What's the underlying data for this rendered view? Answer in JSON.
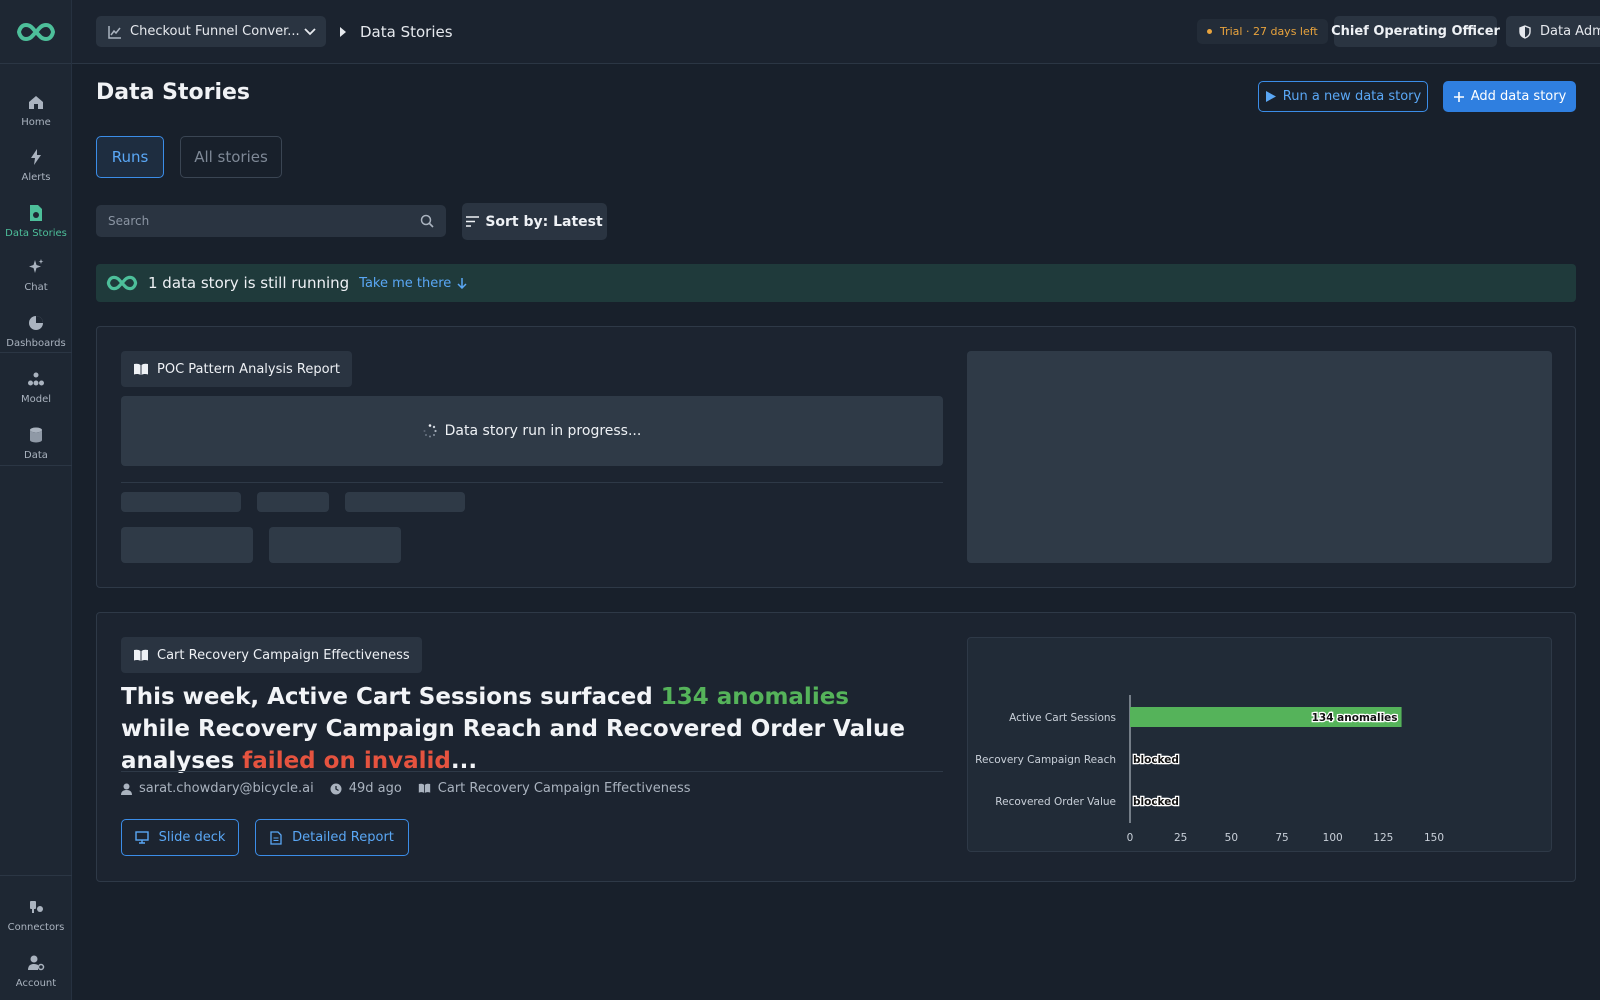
{
  "sidebar": {
    "items": [
      {
        "label": "Home"
      },
      {
        "label": "Alerts"
      },
      {
        "label": "Data Stories"
      },
      {
        "label": "Chat"
      },
      {
        "label": "Dashboards"
      },
      {
        "label": "Model"
      },
      {
        "label": "Data"
      },
      {
        "label": "Connectors"
      },
      {
        "label": "Account"
      }
    ],
    "active_item": "Data Stories"
  },
  "header": {
    "project": "Checkout Funnel Conver...",
    "breadcrumb": "Data Stories",
    "trial": "Trial · 27 days left",
    "role": "Chief Operating Officer",
    "admin": "Data Admin"
  },
  "page": {
    "title": "Data Stories",
    "run_button": "Run a new data story",
    "add_button": "Add data story",
    "tabs": [
      {
        "label": "Runs",
        "active": true
      },
      {
        "label": "All stories",
        "active": false
      }
    ],
    "search_placeholder": "Search",
    "sort_label": "Sort by: Latest"
  },
  "banner": {
    "message": "1 data story is still running",
    "link": "Take me there"
  },
  "cards": [
    {
      "title": "POC Pattern Analysis Report",
      "status": "Data story run in progress..."
    },
    {
      "title": "Cart Recovery Campaign Effectiveness",
      "headline_parts": {
        "a": "This week, Active Cart Sessions surfaced ",
        "b": "134 anomalies",
        "c": " while Recovery Campaign Reach and Recovered Order Value analyses ",
        "d": "failed on invalid",
        "e": "..."
      },
      "author": "sarat.chowdary@bicycle.ai",
      "age": "49d ago",
      "story": "Cart Recovery Campaign Effectiveness",
      "buttons": {
        "slide_deck": "Slide deck",
        "detailed_report": "Detailed Report"
      }
    }
  ],
  "colors": {
    "accent": "#2f7fe0",
    "success": "#55b35a",
    "error": "#e5533f",
    "brand": "#4dbf9a",
    "trial": "#e8a33d"
  },
  "chart_data": {
    "type": "bar",
    "orientation": "horizontal",
    "categories": [
      "Active Cart Sessions",
      "Recovery Campaign Reach",
      "Recovered Order Value"
    ],
    "values": [
      134,
      0,
      0
    ],
    "data_labels": [
      "134 anomalies",
      "blocked",
      "blocked"
    ],
    "xlim": [
      0,
      150
    ],
    "xticks": [
      0,
      25,
      50,
      75,
      100,
      125,
      150
    ],
    "bar_color": "#55b35a"
  }
}
